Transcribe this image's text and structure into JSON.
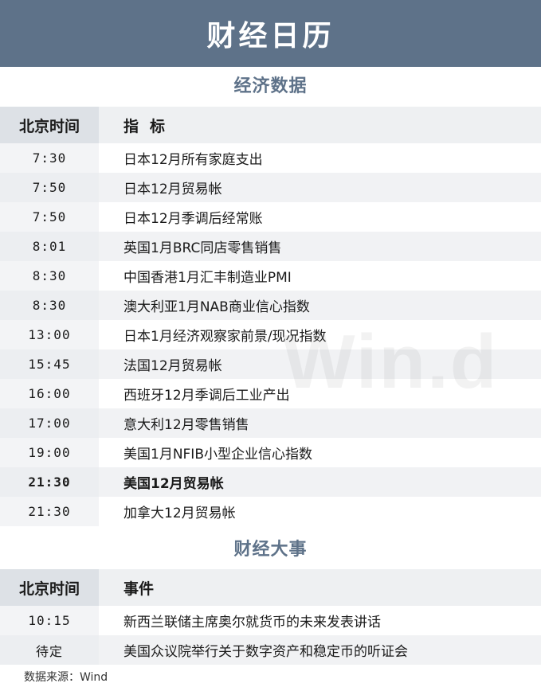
{
  "banner": {
    "title": "财经日历"
  },
  "econ": {
    "section_title": "经济数据",
    "header_time": "北京时间",
    "header_name": "指标",
    "rows": [
      {
        "time": "7:30",
        "name": "日本12月所有家庭支出",
        "bold": false
      },
      {
        "time": "7:50",
        "name": "日本12月贸易帐",
        "bold": false
      },
      {
        "time": "7:50",
        "name": "日本12月季调后经常账",
        "bold": false
      },
      {
        "time": "8:01",
        "name": "英国1月BRC同店零售销售",
        "bold": false
      },
      {
        "time": "8:30",
        "name": "中国香港1月汇丰制造业PMI",
        "bold": false
      },
      {
        "time": "8:30",
        "name": "澳大利亚1月NAB商业信心指数",
        "bold": false
      },
      {
        "time": "13:00",
        "name": "日本1月经济观察家前景/现况指数",
        "bold": false
      },
      {
        "time": "15:45",
        "name": "法国12月贸易帐",
        "bold": false
      },
      {
        "time": "16:00",
        "name": "西班牙12月季调后工业产出",
        "bold": false
      },
      {
        "time": "17:00",
        "name": "意大利12月零售销售",
        "bold": false
      },
      {
        "time": "19:00",
        "name": "美国1月NFIB小型企业信心指数",
        "bold": false
      },
      {
        "time": "21:30",
        "name": "美国12月贸易帐",
        "bold": true
      },
      {
        "time": "21:30",
        "name": "加拿大12月贸易帐",
        "bold": false
      }
    ]
  },
  "events": {
    "section_title": "财经大事",
    "header_time": "北京时间",
    "header_name": "事件",
    "rows": [
      {
        "time": "10:15",
        "name": "新西兰联储主席奥尔就货币的未来发表讲话"
      },
      {
        "time": "待定",
        "name": "美国众议院举行关于数字资产和稳定币的听证会"
      }
    ]
  },
  "watermark": "Win.d",
  "source": "数据来源：Wind"
}
